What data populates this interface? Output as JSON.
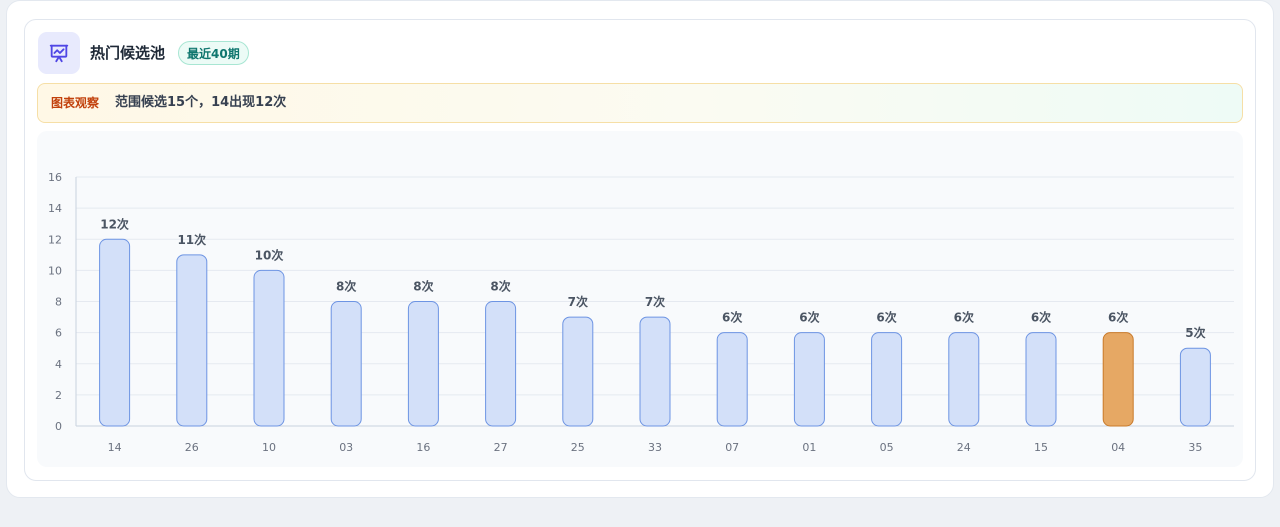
{
  "header": {
    "title": "热门候选池",
    "badge": "最近40期",
    "icon": "presentation-chart-icon"
  },
  "observation": {
    "label": "图表观察",
    "text": "范围候选15个，14出现12次"
  },
  "colors": {
    "bar_fill": "#d3e0f9",
    "bar_stroke": "#6d94e3",
    "highlight_fill": "#e6a864",
    "highlight_stroke": "#c97a2a"
  },
  "chart_data": {
    "type": "bar",
    "categories": [
      "14",
      "26",
      "10",
      "03",
      "16",
      "27",
      "25",
      "33",
      "07",
      "01",
      "05",
      "24",
      "15",
      "04",
      "35"
    ],
    "values": [
      12,
      11,
      10,
      8,
      8,
      8,
      7,
      7,
      6,
      6,
      6,
      6,
      6,
      6,
      5
    ],
    "data_labels": [
      "12次",
      "11次",
      "10次",
      "8次",
      "8次",
      "8次",
      "7次",
      "7次",
      "6次",
      "6次",
      "6次",
      "6次",
      "6次",
      "6次",
      "5次"
    ],
    "highlighted": "04",
    "yticks": [
      "0",
      "2",
      "4",
      "6",
      "8",
      "10",
      "12",
      "14",
      "16"
    ],
    "ylim": [
      0,
      16
    ],
    "grid": true
  }
}
